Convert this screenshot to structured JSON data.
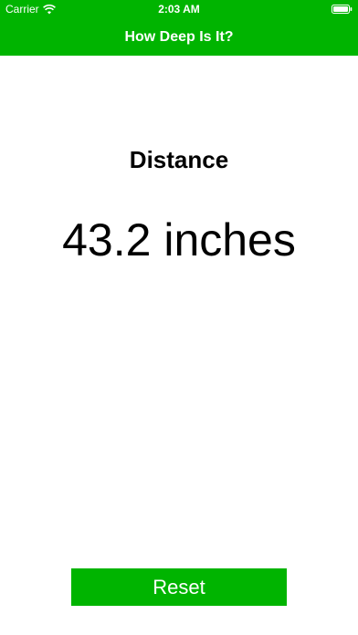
{
  "status_bar": {
    "carrier": "Carrier",
    "time": "2:03 AM",
    "icons": [
      "wifi-icon",
      "battery-icon"
    ]
  },
  "nav": {
    "title": "How Deep Is It?"
  },
  "main": {
    "label": "Distance",
    "value": "43.2 inches"
  },
  "actions": {
    "reset_label": "Reset"
  },
  "colors": {
    "accent": "#00b400",
    "background": "#ffffff",
    "text": "#000000"
  }
}
